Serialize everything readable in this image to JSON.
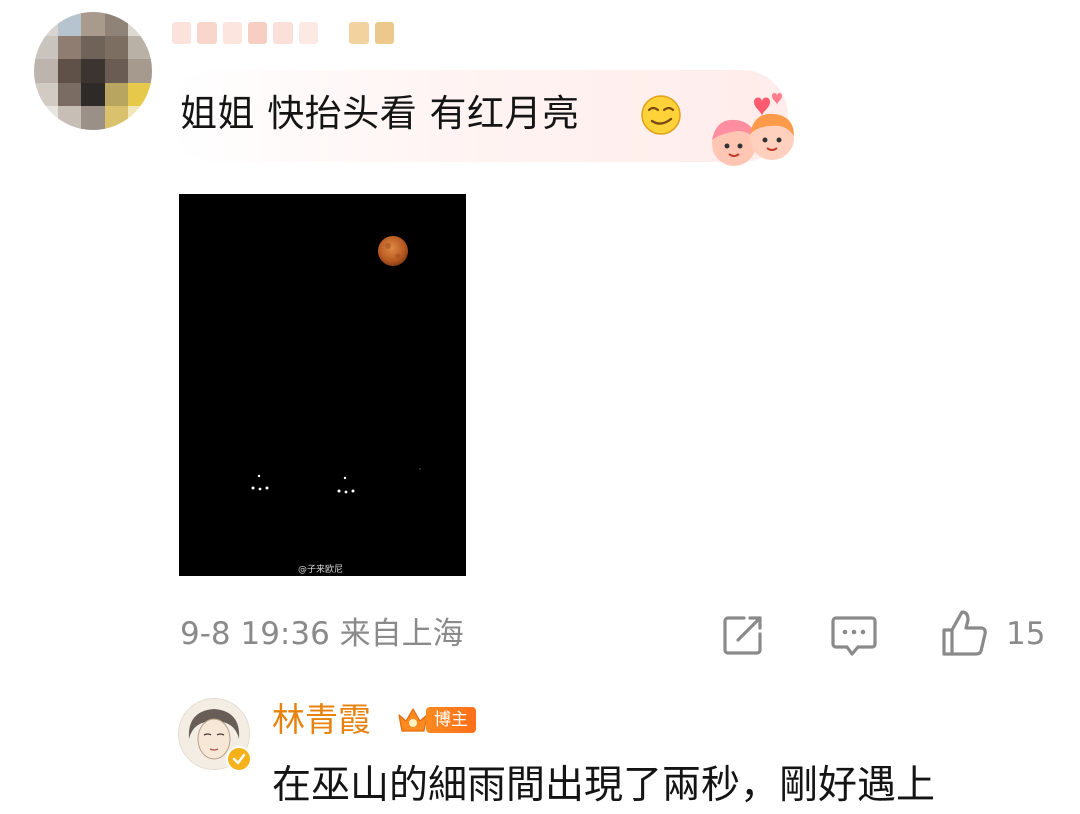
{
  "comment": {
    "text": "姐姐 快抬头看 有红月亮",
    "emoji": "smirk-emoji",
    "sticker": "couple-hearts-sticker",
    "image": {
      "watermark": "@子来欧尼"
    },
    "meta": {
      "time_location": "9-8 19:36 来自上海",
      "like_count": "15"
    },
    "icons": [
      "share-icon",
      "comment-icon",
      "like-icon"
    ]
  },
  "reply": {
    "author": "林青霞",
    "badge": "博主",
    "text": "在巫山的細雨間出現了兩秒，剛好遇上",
    "badge_color": "#ff7a1a",
    "name_color": "#e8820c"
  },
  "colors": {
    "meta_gray": "#8a8a8a",
    "moon": "#c96a2c"
  }
}
